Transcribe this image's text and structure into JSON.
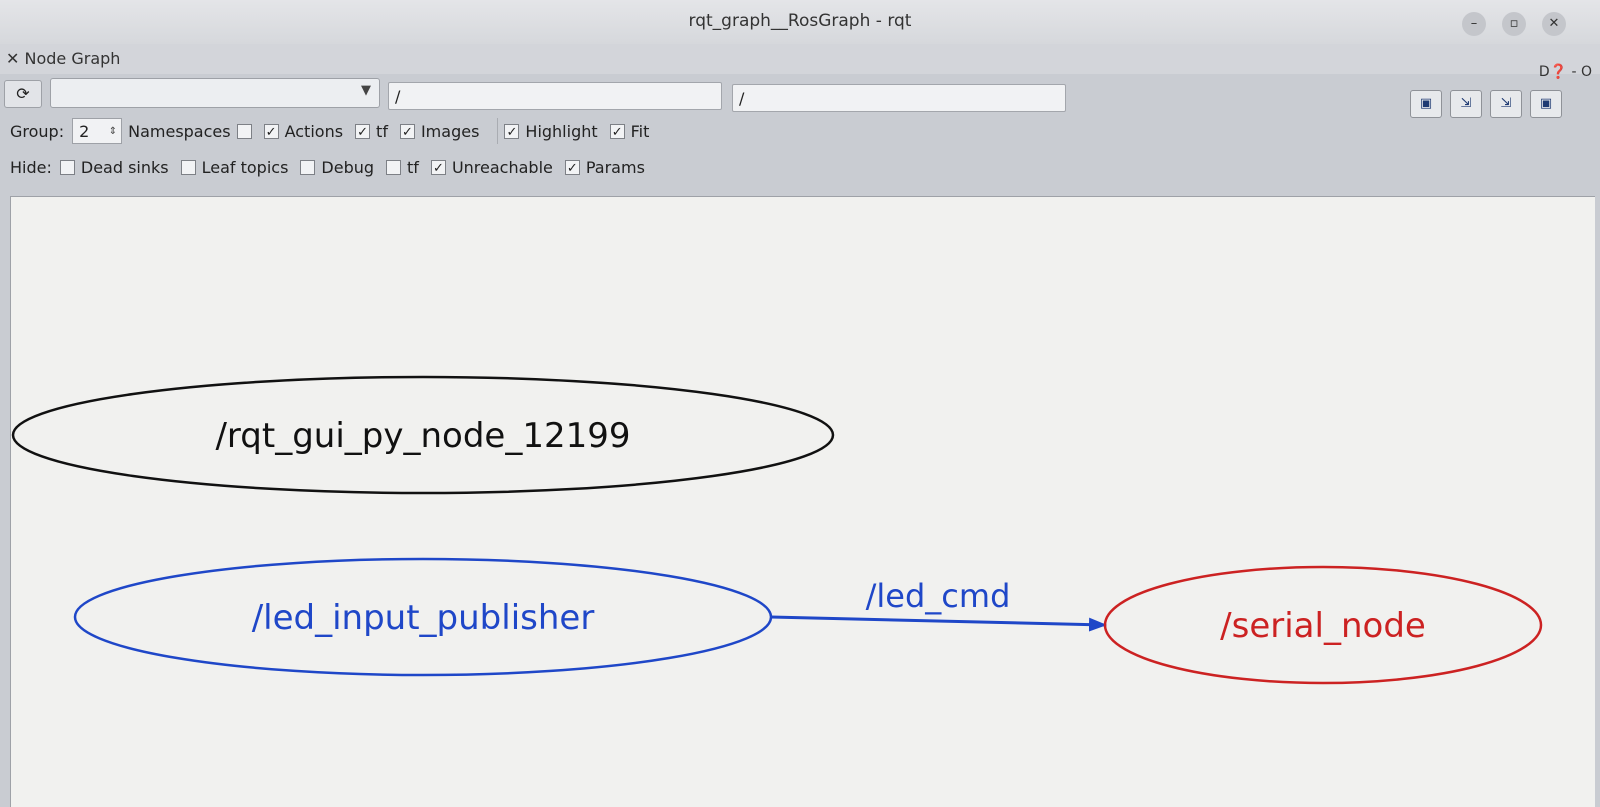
{
  "window": {
    "title": "rqt_graph__RosGraph - rqt",
    "controls": [
      "–",
      "▫",
      "✕"
    ]
  },
  "panel": {
    "title": "Node Graph",
    "right_buttons": "D❓ - O"
  },
  "filters": {
    "node_filter": "/",
    "topic_filter": "/"
  },
  "group_row": {
    "group_label": "Group:",
    "group_value": "2",
    "options": [
      {
        "label": "Namespaces",
        "checked": false
      },
      {
        "label": "Actions",
        "checked": true
      },
      {
        "label": "tf",
        "checked": true
      },
      {
        "label": "Images",
        "checked": true
      },
      {
        "label": "Highlight",
        "checked": true
      },
      {
        "label": "Fit",
        "checked": true
      }
    ]
  },
  "hide_row": {
    "hide_label": "Hide:",
    "options": [
      {
        "label": "Dead sinks",
        "checked": false
      },
      {
        "label": "Leaf topics",
        "checked": false
      },
      {
        "label": "Debug",
        "checked": false
      },
      {
        "label": "tf",
        "checked": false
      },
      {
        "label": "Unreachable",
        "checked": true
      },
      {
        "label": "Params",
        "checked": true
      }
    ]
  },
  "graph": {
    "nodes": [
      {
        "id": "rqt",
        "label": "/rqt_gui_py_node_12199",
        "color": "#111111"
      },
      {
        "id": "pub",
        "label": "/led_input_publisher",
        "color": "#1f47c8"
      },
      {
        "id": "ser",
        "label": "/serial_node",
        "color": "#cc2222"
      }
    ],
    "edges": [
      {
        "from": "pub",
        "to": "ser",
        "label": "/led_cmd",
        "color": "#1f47c8"
      }
    ]
  }
}
